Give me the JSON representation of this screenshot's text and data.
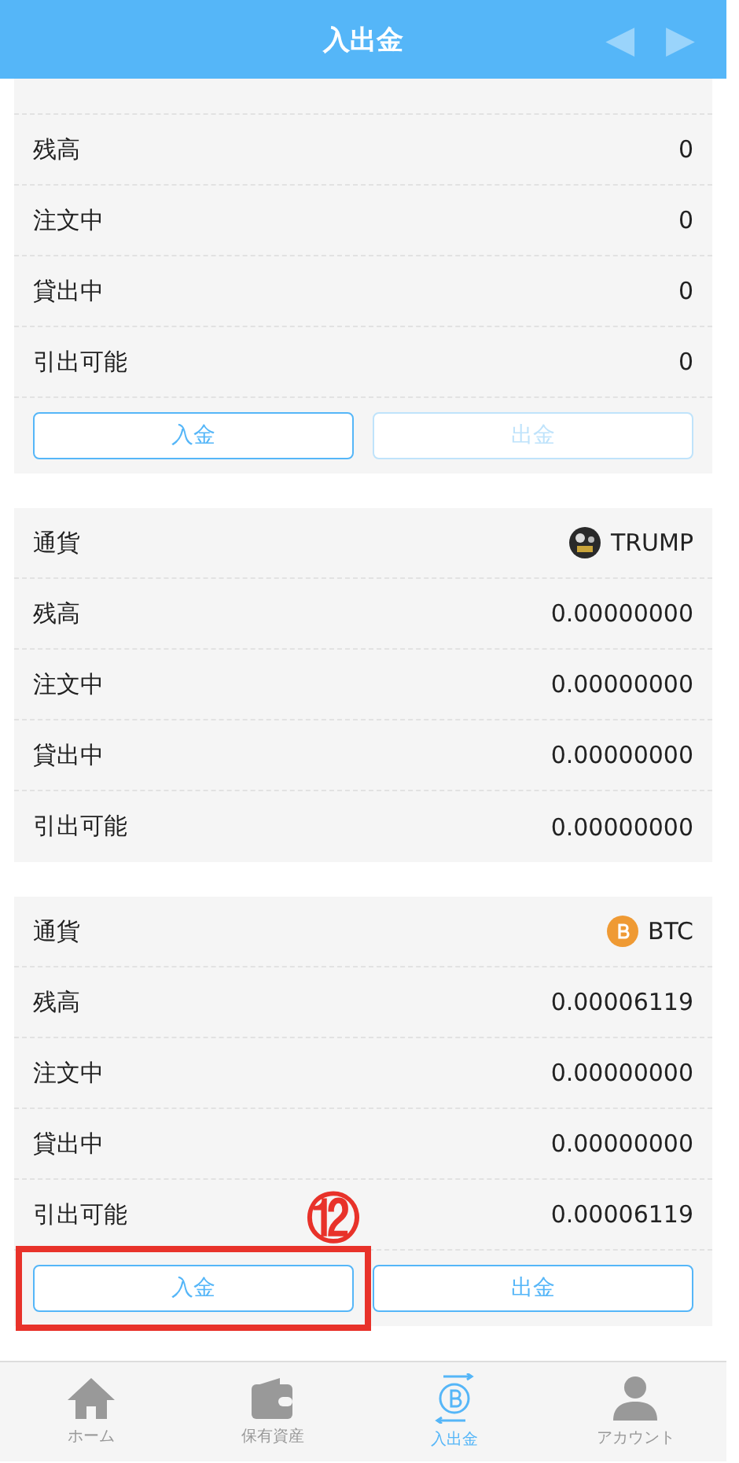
{
  "header": {
    "title": "入出金",
    "prev_arrow": "◀",
    "next_arrow": "▶"
  },
  "cards": [
    {
      "kind": "clipped-top",
      "rows": [
        {
          "label": "残高",
          "value": "0"
        },
        {
          "label": "注文中",
          "value": "0"
        },
        {
          "label": "貸出中",
          "value": "0"
        },
        {
          "label": "引出可能",
          "value": "0"
        }
      ],
      "buttons": [
        {
          "label": "入金",
          "disabled": false
        },
        {
          "label": "出金",
          "disabled": true
        }
      ]
    },
    {
      "kind": "full",
      "currency": {
        "code": "TRUMP",
        "kind": "trump",
        "label": "通貨"
      },
      "rows": [
        {
          "label": "残高",
          "value": "0.00000000"
        },
        {
          "label": "注文中",
          "value": "0.00000000"
        },
        {
          "label": "貸出中",
          "value": "0.00000000"
        },
        {
          "label": "引出可能",
          "value": "0.00000000"
        }
      ]
    },
    {
      "kind": "full",
      "currency": {
        "code": "BTC",
        "kind": "btc",
        "label": "通貨"
      },
      "rows": [
        {
          "label": "残高",
          "value": "0.00006119"
        },
        {
          "label": "注文中",
          "value": "0.00000000"
        },
        {
          "label": "貸出中",
          "value": "0.00000000"
        },
        {
          "label": "引出可能",
          "value": "0.00006119"
        }
      ],
      "buttons": [
        {
          "label": "入金",
          "disabled": false,
          "highlighted": true
        },
        {
          "label": "出金",
          "disabled": false
        }
      ]
    }
  ],
  "annotation": {
    "label": "⑫"
  },
  "tab_bar": [
    {
      "label": "ホーム",
      "kind": "home",
      "selected": false
    },
    {
      "label": "保有資産",
      "kind": "wallet",
      "selected": false
    },
    {
      "label": "入出金",
      "kind": "transfer",
      "selected": true
    },
    {
      "label": "アカウント",
      "kind": "person",
      "selected": false
    }
  ]
}
